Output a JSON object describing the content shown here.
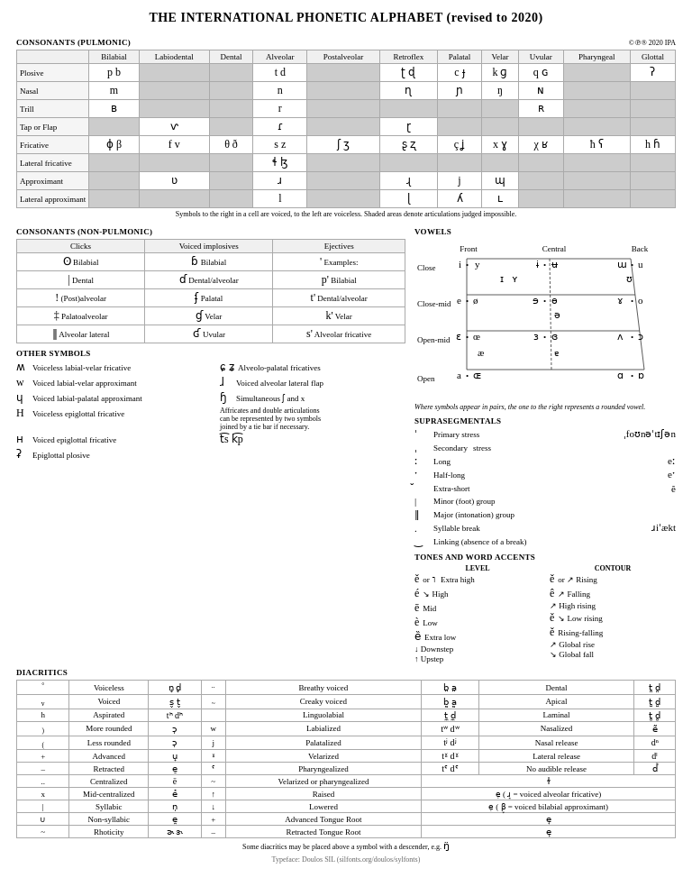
{
  "title": "THE INTERNATIONAL PHONETIC ALPHABET (revised to 2020)",
  "copyright": "©℗® 2020 IPA",
  "consonants_pulmonic": {
    "label": "CONSONANTS (PULMONIC)",
    "columns": [
      "",
      "Bilabial",
      "Labiodental",
      "Dental",
      "Alveolar",
      "Postalveolar",
      "Retroflex",
      "Palatal",
      "Velar",
      "Uvular",
      "Pharyngeal",
      "Glottal"
    ],
    "rows": [
      {
        "label": "Plosive",
        "cells": [
          "",
          "p b",
          "",
          "",
          "t d",
          "",
          "ʈ ɖ",
          "c ɟ",
          "k ɡ",
          "q ɢ",
          "",
          "ʔ"
        ]
      },
      {
        "label": "Nasal",
        "cells": [
          "",
          "m",
          "",
          "",
          "n",
          "",
          "ɳ",
          "ɲ",
          "ŋ",
          "ɴ",
          "",
          ""
        ]
      },
      {
        "label": "Trill",
        "cells": [
          "",
          "ʙ",
          "",
          "",
          "r",
          "",
          "",
          "",
          "",
          "ʀ",
          "",
          ""
        ]
      },
      {
        "label": "Tap or Flap",
        "cells": [
          "",
          "",
          "ⱱ",
          "",
          "ɾ",
          "",
          "ɽ",
          "",
          "",
          "",
          "",
          ""
        ]
      },
      {
        "label": "Fricative",
        "cells": [
          "",
          "ɸ β",
          "f v",
          "θ ð",
          "s z",
          "ʃ ʒ",
          "ʂ ʐ",
          "ç ʝ",
          "x ɣ",
          "χ ʁ",
          "ħ ʕ",
          "h ɦ"
        ]
      },
      {
        "label": "Lateral fricative",
        "cells": [
          "",
          "",
          "",
          "",
          "ɬ ɮ",
          "",
          "",
          "",
          "",
          "",
          "",
          ""
        ]
      },
      {
        "label": "Approximant",
        "cells": [
          "",
          "",
          "ʋ",
          "",
          "ɹ",
          "",
          "ɻ",
          "j",
          "ɰ",
          "",
          "",
          ""
        ]
      },
      {
        "label": "Lateral approximant",
        "cells": [
          "",
          "",
          "",
          "",
          "l",
          "",
          "ɭ",
          "ʎ",
          "ʟ",
          "",
          "",
          ""
        ]
      }
    ],
    "note": "Symbols to the right in a cell are voiced, to the left are voiceless. Shaded areas denote articulations judged impossible."
  },
  "consonants_nonpulmonic": {
    "label": "CONSONANTS (NON-PULMONIC)",
    "clicks_header": "Clicks",
    "voiced_implosives_header": "Voiced implosives",
    "ejectives_header": "Ejectives",
    "clicks": [
      {
        "symbol": "ʘ",
        "label": "Bilabial"
      },
      {
        "symbol": "|",
        "label": "Dental"
      },
      {
        "symbol": "!",
        "label": "(Post)alveolar"
      },
      {
        "symbol": "‡",
        "label": "Palatoalveolar"
      },
      {
        "symbol": "‖",
        "label": "Alveolar lateral"
      }
    ],
    "implosives": [
      {
        "symbol": "ɓ",
        "label": "Bilabial"
      },
      {
        "symbol": "ɗ",
        "label": "Dental/alveolar"
      },
      {
        "symbol": "ʄ",
        "label": "Palatal"
      },
      {
        "symbol": "ɠ",
        "label": "Velar"
      },
      {
        "symbol": "ʛ",
        "label": "Uvular"
      }
    ],
    "ejectives": [
      {
        "symbol": "'",
        "label": "Examples:"
      },
      {
        "symbol": "p'",
        "label": "Bilabial"
      },
      {
        "symbol": "t'",
        "label": "Dental/alveolar"
      },
      {
        "symbol": "k'",
        "label": "Velar"
      },
      {
        "symbol": "s'",
        "label": "Alveolar fricative"
      }
    ]
  },
  "other_symbols": {
    "label": "OTHER SYMBOLS",
    "items": [
      {
        "symbol": "ʍ",
        "label": "Voiceless labial-velar fricative"
      },
      {
        "symbol": "ɕ ʑ",
        "label": "Alveolo-palatal fricatives"
      },
      {
        "symbol": "w",
        "label": "Voiced labial-velar approximant"
      },
      {
        "symbol": "ɺ",
        "label": "Voiced alveolar lateral flap"
      },
      {
        "symbol": "ɥ",
        "label": "Voiced labial-palatal approximant"
      },
      {
        "symbol": "ɧ",
        "label": "Simultaneous ʃ and x"
      },
      {
        "symbol": "H",
        "label": "Voiceless epiglottal fricative"
      },
      {
        "symbol": "",
        "label": "Affricates and double articulations can be represented by two symbols joined by a tie bar if necessary."
      },
      {
        "symbol": "ʜ",
        "label": "Voiced epiglottal fricative"
      },
      {
        "symbol": "ts k͡p",
        "label": ""
      },
      {
        "symbol": "ʡ",
        "label": "Epiglottal plosive"
      }
    ]
  },
  "vowels": {
    "label": "VOWELS",
    "headers": [
      "Front",
      "Central",
      "Back"
    ],
    "rows": [
      {
        "label": "Close",
        "symbols": "i • y  ɨ • ʉ  ɯ • u"
      },
      {
        "label": "Close-mid",
        "symbols": "e • ø  ɘ • ɵ  ɤ • o"
      },
      {
        "label": "Open-mid",
        "symbols": "ɛ • œ  ɜ • ɞ  ʌ • ɔ"
      },
      {
        "label": "Open",
        "symbols": "a • æ (raised)  ä • ɶ  ɑ • ɒ"
      }
    ],
    "note": "Where symbols appear in pairs, the one to the right represents a rounded vowel."
  },
  "suprasegmentals": {
    "label": "SUPRASEGMENTALS",
    "items": [
      {
        "symbol": "ˈ",
        "label": "Primary stress",
        "example": "ˌfoʊnəˈtɪʃən"
      },
      {
        "symbol": "ˌ",
        "label": "Secondary stress",
        "example": ""
      },
      {
        "symbol": "ː",
        "label": "Long",
        "example": "eː"
      },
      {
        "symbol": "ˑ",
        "label": "Half-long",
        "example": "eˑ"
      },
      {
        "symbol": "̆",
        "label": "Extra-short",
        "example": "ĕ"
      },
      {
        "symbol": "|",
        "label": "Minor (foot) group",
        "example": ""
      },
      {
        "symbol": "‖",
        "label": "Major (intonation) group",
        "example": ""
      },
      {
        "symbol": ".",
        "label": "Syllable break",
        "example": "ɹiˈækt"
      },
      {
        "symbol": "‿",
        "label": "Linking (absence of a break)",
        "example": ""
      }
    ]
  },
  "tones": {
    "label": "TONES AND WORD ACCENTS",
    "level_header": "LEVEL",
    "contour_header": "CONTOUR",
    "items": [
      {
        "symbol": "ě or ˥",
        "label": "Extra high",
        "contour_symbol": "ě or",
        "contour_label": "Rising"
      },
      {
        "symbol": "é ˦",
        "label": "High",
        "contour_symbol": "ê ↗",
        "contour_label": "Falling"
      },
      {
        "symbol": "ē ˧",
        "label": "Mid",
        "contour_symbol": "",
        "contour_label": "High rising"
      },
      {
        "symbol": "è ˨",
        "label": "Low",
        "contour_symbol": "ě ↘",
        "contour_label": "Low rising"
      },
      {
        "symbol": "ȅ ˩",
        "label": "Extra low",
        "contour_symbol": "ě",
        "contour_label": "Rising-falling"
      },
      {
        "symbol": "↓",
        "label": "Downstep",
        "contour_symbol": "↗",
        "contour_label": "Global rise"
      },
      {
        "symbol": "↑",
        "label": "Upstep",
        "contour_symbol": "↘",
        "contour_label": "Global fall"
      }
    ]
  },
  "diacritics": {
    "label": "DIACRITICS",
    "note": "Diacritics may be placed above a symbol with a descender, e.g. ŋ̈",
    "rows": [
      {
        "symbol": "n̥ d̥",
        "label": "Voiceless",
        "symbol2": "b̤ a̤",
        "label2": "Breathy voiced",
        "symbol3": "t̪ d̪",
        "label3": "Dental"
      },
      {
        "symbol": "s̬ t̬",
        "label": "Voiced",
        "symbol2": "b̰ a̰",
        "label2": "Creaky voiced",
        "symbol3": "t̺ d̺",
        "label3": "Apical"
      },
      {
        "symbol": "tʰ dʰ",
        "label": "Aspirated",
        "symbol2": "t̼ d̼",
        "label2": "Linguolabial",
        "symbol3": "t̻ d̻",
        "label3": "Laminal"
      },
      {
        "symbol": "ɔ̹",
        "label": "More rounded",
        "symbol2": "tʷ dʷ",
        "label2": "Labialized",
        "symbol3": "ẽ",
        "label3": "Nasalized"
      },
      {
        "symbol": "ɔ̜",
        "label": "Less rounded",
        "symbol2": "tʲ dʲ",
        "label2": "Palatalized",
        "symbol3": "dⁿ",
        "label3": "Nasal release"
      },
      {
        "symbol": "u̟",
        "label": "Advanced",
        "symbol2": "tˠ dˠ",
        "label2": "Velarized",
        "symbol3": "dˡ",
        "label3": "Lateral release"
      },
      {
        "symbol": "e̠",
        "label": "Retracted",
        "symbol2": "tˤ dˤ",
        "label2": "Pharyngealized",
        "symbol3": "d̚",
        "label3": "No audible release"
      },
      {
        "symbol": "ë",
        "label": "Centralized",
        "symbol2": "~",
        "label2": "Velarized or pharyngealized",
        "symbol3": "ɫ",
        "label3": ""
      },
      {
        "symbol": "e̽",
        "label": "Mid-centralized",
        "symbol2": "e̝",
        "label2": "Raised",
        "symbol3": "ɹ̝ = voiced alveolar fricative",
        "label3": ""
      },
      {
        "symbol": "n̩",
        "label": "Syllabic",
        "symbol2": "e̞",
        "label2": "Lowered",
        "symbol3": "β̞ = voiced bilabial approximant",
        "label3": ""
      },
      {
        "symbol": "e̯",
        "label": "Non-syllabic",
        "symbol2": "e̘",
        "label2": "Advanced Tongue Root",
        "symbol3": "e̘",
        "label3": ""
      },
      {
        "symbol": "ɚ ɝ",
        "label": "Rhoticity",
        "symbol2": "e̙",
        "label2": "Retracted Tongue Root",
        "symbol3": "e̙",
        "label3": ""
      }
    ]
  },
  "footer": "Typeface: Doulos SIL (silfonts.org/doulos/sylfonts)",
  "secondary_label": "Secondary"
}
